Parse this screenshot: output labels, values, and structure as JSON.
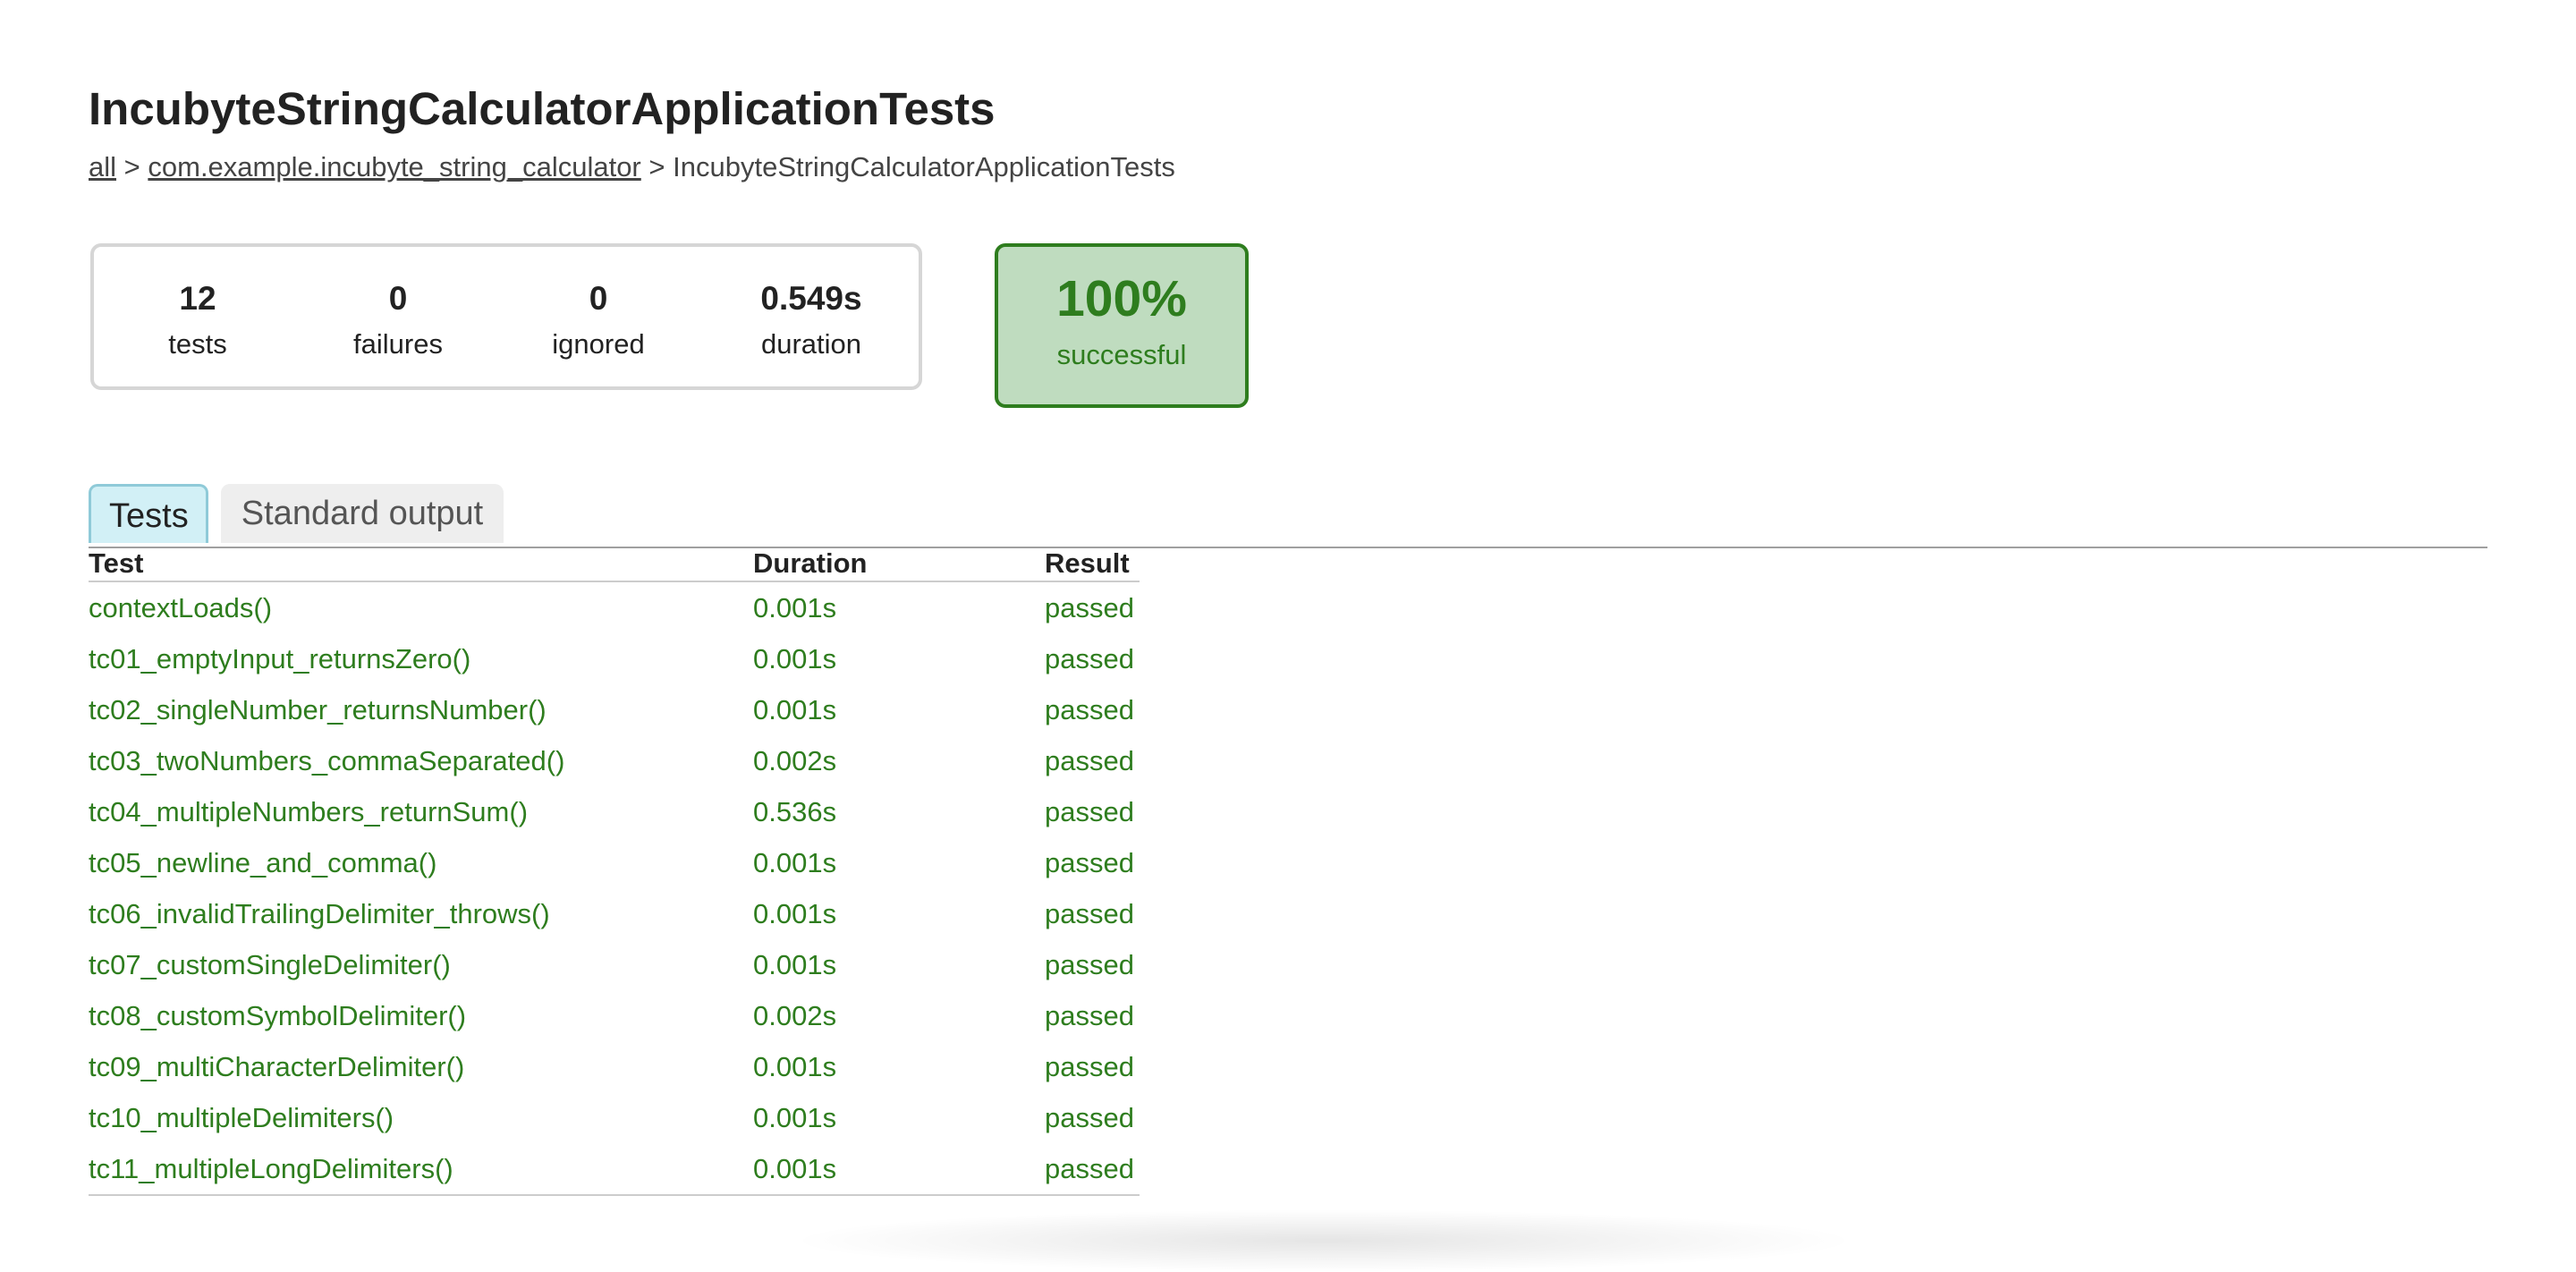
{
  "page": {
    "title": "IncubyteStringCalculatorApplicationTests"
  },
  "breadcrumb": {
    "root_link": "all",
    "separator": ">",
    "package_link": "com.example.incubyte_string_calculator",
    "current": "IncubyteStringCalculatorApplicationTests"
  },
  "summary": {
    "tests": {
      "value": "12",
      "label": "tests"
    },
    "failures": {
      "value": "0",
      "label": "failures"
    },
    "ignored": {
      "value": "0",
      "label": "ignored"
    },
    "duration": {
      "value": "0.549s",
      "label": "duration"
    },
    "success": {
      "value": "100%",
      "label": "successful"
    }
  },
  "tabs": [
    {
      "label": "Tests",
      "selected": true
    },
    {
      "label": "Standard output",
      "selected": false
    }
  ],
  "table": {
    "headers": [
      "Test",
      "Duration",
      "Result"
    ],
    "rows": [
      {
        "test": "contextLoads()",
        "duration": "0.001s",
        "result": "passed"
      },
      {
        "test": "tc01_emptyInput_returnsZero()",
        "duration": "0.001s",
        "result": "passed"
      },
      {
        "test": "tc02_singleNumber_returnsNumber()",
        "duration": "0.001s",
        "result": "passed"
      },
      {
        "test": "tc03_twoNumbers_commaSeparated()",
        "duration": "0.002s",
        "result": "passed"
      },
      {
        "test": "tc04_multipleNumbers_returnSum()",
        "duration": "0.536s",
        "result": "passed"
      },
      {
        "test": "tc05_newline_and_comma()",
        "duration": "0.001s",
        "result": "passed"
      },
      {
        "test": "tc06_invalidTrailingDelimiter_throws()",
        "duration": "0.001s",
        "result": "passed"
      },
      {
        "test": "tc07_customSingleDelimiter()",
        "duration": "0.001s",
        "result": "passed"
      },
      {
        "test": "tc08_customSymbolDelimiter()",
        "duration": "0.002s",
        "result": "passed"
      },
      {
        "test": "tc09_multiCharacterDelimiter()",
        "duration": "0.001s",
        "result": "passed"
      },
      {
        "test": "tc10_multipleDelimiters()",
        "duration": "0.001s",
        "result": "passed"
      },
      {
        "test": "tc11_multipleLongDelimiters()",
        "duration": "0.001s",
        "result": "passed"
      }
    ]
  },
  "colors": {
    "success": "#2e7d1e",
    "success_bg": "#bfdcbf",
    "tab_selected_bg": "#d2f0f6"
  }
}
